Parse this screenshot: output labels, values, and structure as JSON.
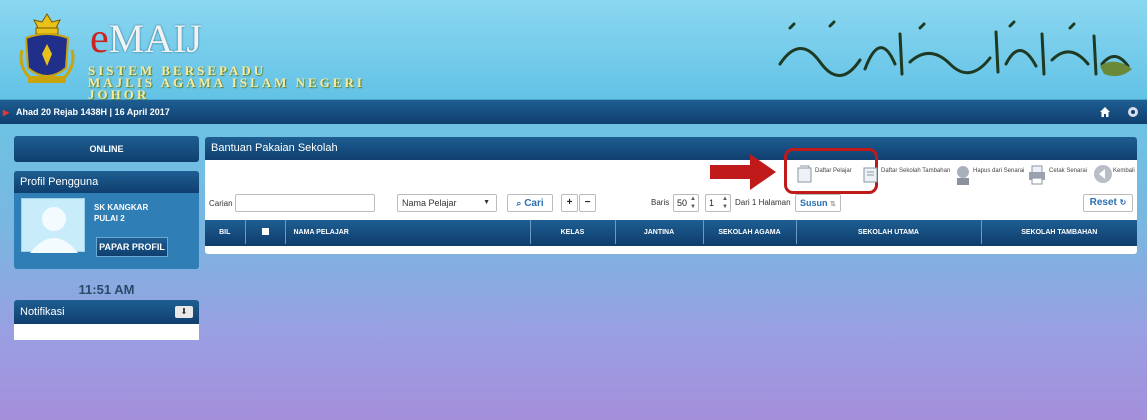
{
  "header": {
    "logo_e": "e",
    "logo_rest": "MAIJ",
    "subtitle_line1": "SISTEM BERSEPADU",
    "subtitle_line2": "MAJLIS AGAMA ISLAM NEGERI JOHOR"
  },
  "datebar": {
    "date": "Ahad 20 Rejab 1438H | 16 April 2017"
  },
  "sidebar": {
    "online_label": "ONLINE",
    "profile_title": "Profil Pengguna",
    "school_line1": "SK KANGKAR",
    "school_line2": "PULAI 2",
    "papar_profil_label": "PAPAR PROFIL",
    "clock": "11:51 AM",
    "notifikasi_label": "Notifikasi"
  },
  "main": {
    "title": "Bantuan Pakaian Sekolah",
    "toolbar": {
      "daftar_pelajar": "Daftar Pelajar",
      "daftar_sekolah_tambahan": "Daftar Sekolah Tambahan",
      "hapus_dari_senarai": "Hapus dari Senarai",
      "cetak_senarai": "Cetak Senarai",
      "kembali": "Kembali"
    },
    "search": {
      "label": "Carian",
      "value": "",
      "field_selected": "Nama Pelajar",
      "cari_label": "Cari",
      "baris_label": "Baris",
      "baris_value": "50",
      "page_value": "1",
      "dari_label": "Dari 1 Halaman",
      "susun_label": "Susun",
      "reset_label": "Reset"
    },
    "columns": [
      "BIL",
      "",
      "NAMA PELAJAR",
      "KELAS",
      "JANTINA",
      "SEKOLAH AGAMA",
      "SEKOLAH UTAMA",
      "SEKOLAH TAMBAHAN"
    ]
  },
  "colors": {
    "header_bg": "#63c2e6",
    "bar_dark": "#0f3f6f",
    "highlight": "#c0191a",
    "link_blue": "#2a6fb0"
  }
}
